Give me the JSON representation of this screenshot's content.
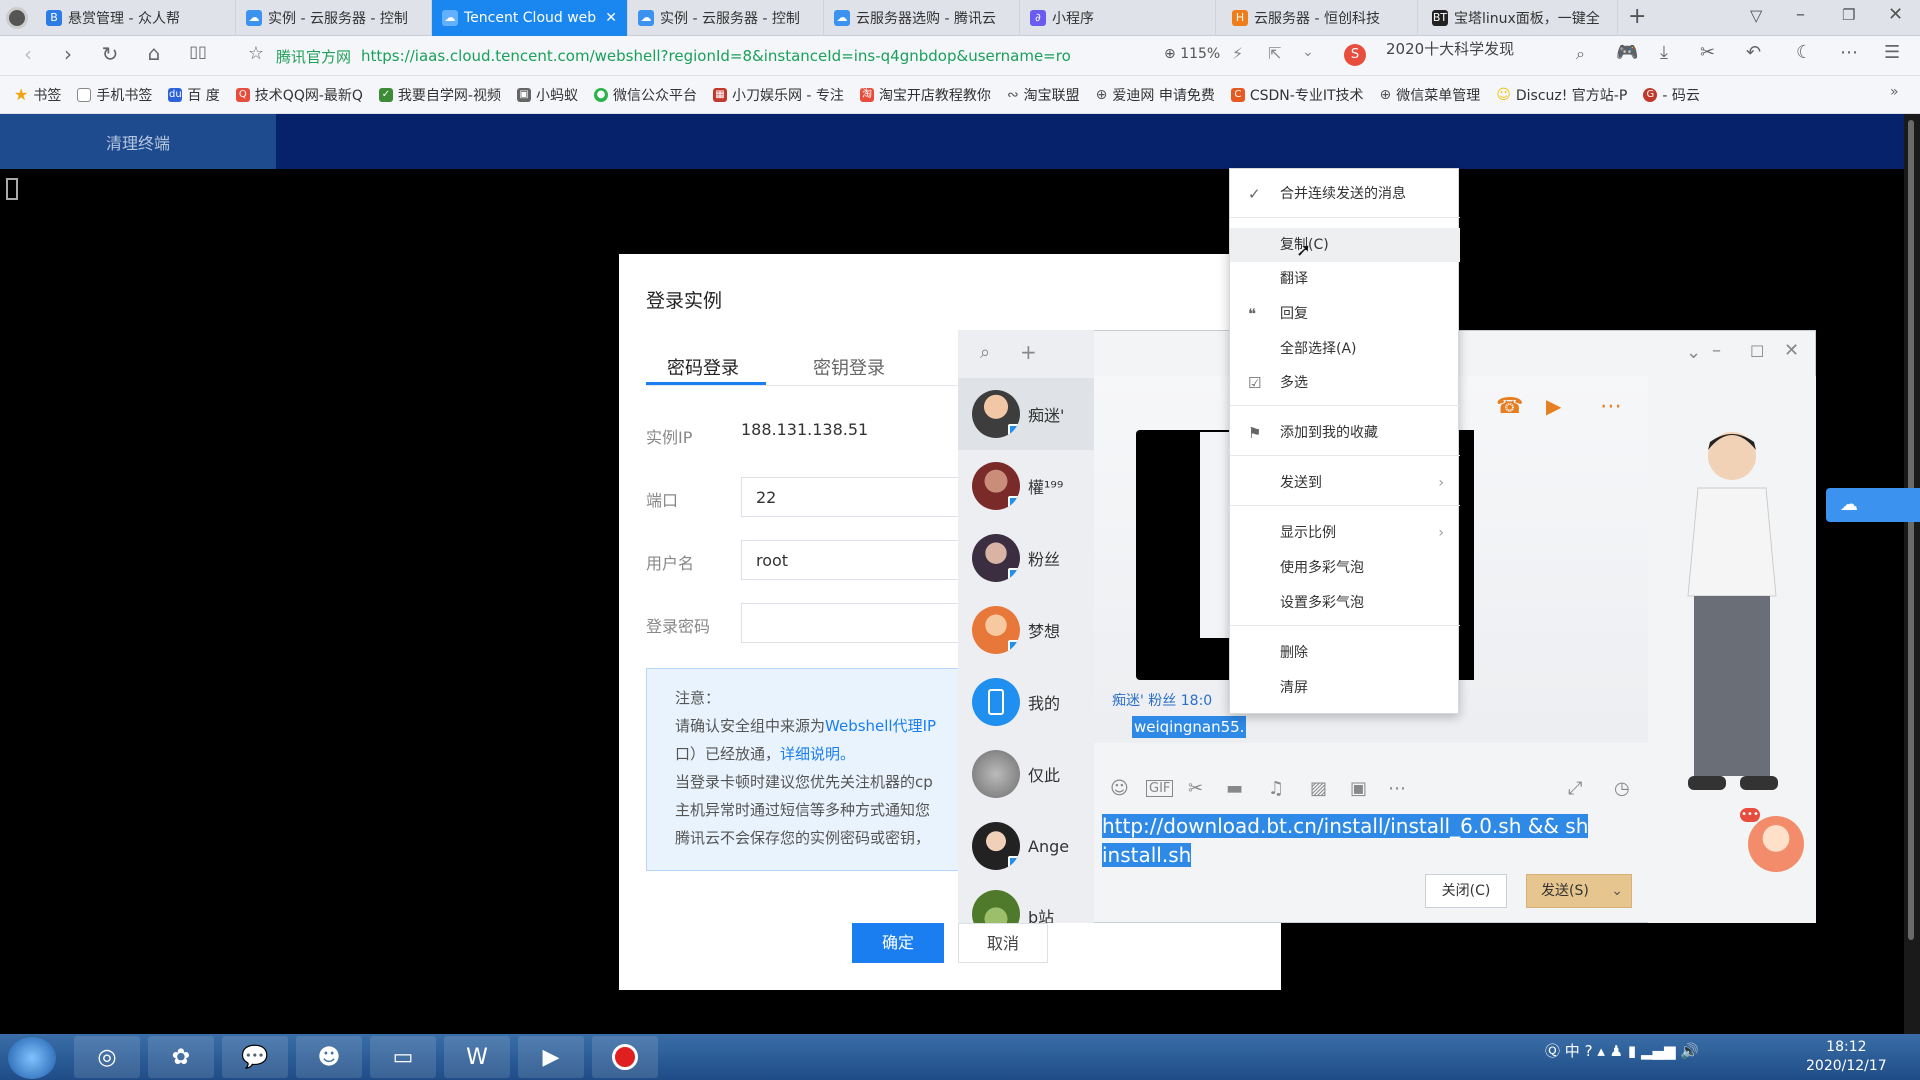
{
  "tabs": [
    {
      "label": "悬赏管理 - 众人帮",
      "icon": "zrb-icon"
    },
    {
      "label": "实例 - 云服务器 - 控制",
      "icon": "cloud-icon"
    },
    {
      "label": "Tencent Cloud web",
      "icon": "cloud-icon",
      "active": true
    },
    {
      "label": "实例 - 云服务器 - 控制",
      "icon": "cloud-icon"
    },
    {
      "label": "云服务器选购 - 腾讯云",
      "icon": "cloud-icon"
    },
    {
      "label": "小程序",
      "icon": "miniprogram-icon"
    },
    {
      "label": "云服务器 - 恒创科技",
      "icon": "hc-icon"
    },
    {
      "label": "宝塔linux面板，一键全",
      "icon": "bt-icon"
    }
  ],
  "address": {
    "site_label": "腾讯官方网",
    "url": "https://iaas.cloud.tencent.com/webshell?regionId=8&instanceId=ins-q4gnbdop&username=ro",
    "zoom": "115%",
    "search_hint": "2020十大科学发现"
  },
  "bookmarks": [
    "书签",
    "手机书签",
    "百 度",
    "技术QQ网-最新Q",
    "我要自学网-视频",
    "小蚂蚁",
    "微信公众平台",
    "小刀娱乐网 - 专注",
    "淘宝开店教程教你",
    "淘宝联盟",
    "爱迪网 申请免费",
    "CSDN-专业IT技术",
    "微信菜单管理",
    "Discuz! 官方站-P",
    "- 码云"
  ],
  "page": {
    "clear_terminal": "清理终端"
  },
  "login": {
    "title": "登录实例",
    "tab_password": "密码登录",
    "tab_key": "密钥登录",
    "ip_label": "实例IP",
    "ip_value": "188.131.138.51",
    "port_label": "端口",
    "port_value": "22",
    "user_label": "用户名",
    "user_value": "root",
    "password_label": "登录密码",
    "notice_title": "注意：",
    "notice_l1a": "请确认安全组中来源为",
    "notice_l1b": "Webshell代理IP",
    "notice_l2a": "口）已经放通，",
    "notice_l2b": "详细说明。",
    "notice_l3": "当登录卡顿时建议您优先关注机器的cp",
    "notice_l4": "主机异常时通过短信等多种方式通知您",
    "notice_l5": "腾讯云不会保存您的实例密码或密钥，",
    "ok": "确定",
    "cancel": "取消"
  },
  "chat": {
    "contacts": [
      "痴迷'",
      "權¹⁹⁹",
      "粉丝",
      "梦想",
      "我的",
      "仅此",
      "Ange",
      "b站"
    ],
    "msg_meta": "痴迷'  粉丝  18:0",
    "msg_text": "weiqingnan55.",
    "compose_text": "http://download.bt.cn/install/install_6.0.sh && sh install.sh",
    "close_btn": "关闭(C)",
    "send_btn": "发送(S)"
  },
  "context_menu": {
    "items": [
      {
        "label": "合并连续发送的消息",
        "icon": "check-icon"
      },
      {
        "label": "复制(C)",
        "highlight": true
      },
      {
        "label": "翻译"
      },
      {
        "label": "回复",
        "icon": "reply-icon"
      },
      {
        "label": "全部选择(A)"
      },
      {
        "label": "多选",
        "icon": "multiselect-icon"
      },
      {
        "label": "添加到我的收藏",
        "icon": "bookmark-icon"
      },
      {
        "label": "发送到",
        "submenu": true
      },
      {
        "label": "显示比例",
        "submenu": true
      },
      {
        "label": "使用多彩气泡"
      },
      {
        "label": "设置多彩气泡"
      },
      {
        "label": "删除"
      },
      {
        "label": "清屏"
      }
    ]
  },
  "taskbar": {
    "ime": "中",
    "time": "18:12",
    "date": "2020/12/17"
  },
  "colors": {
    "tab_active": "#1a86f0",
    "page_header": "#06226b",
    "primary_button": "#1a7ef0",
    "selection": "#2e8ae6",
    "send_button": "#e7c58e"
  }
}
